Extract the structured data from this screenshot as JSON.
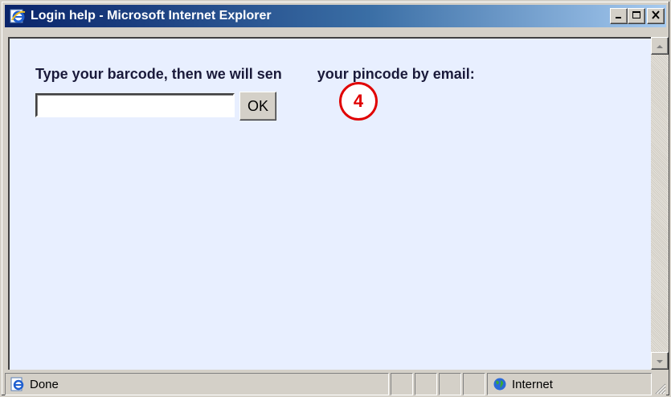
{
  "window": {
    "title": "Login help - Microsoft Internet Explorer",
    "icon": "internet-explorer-icon"
  },
  "title_buttons": {
    "minimize_icon": "minimize-icon",
    "maximize_icon": "maximize-icon",
    "close_icon": "close-icon"
  },
  "content": {
    "prompt": "Type your barcode, then we will sen",
    "prompt_tail": "your pincode by email:",
    "barcode_value": "",
    "barcode_placeholder": "",
    "ok_label": "OK",
    "marker_number": "4"
  },
  "status": {
    "text": "Done",
    "page_icon": "ie-page-icon",
    "zone_icon": "globe-icon",
    "zone_text": "Internet"
  },
  "colors": {
    "titlebar_start": "#0a246a",
    "titlebar_end": "#a6caf0",
    "content_bg": "#e8efff",
    "marker": "#e00000"
  }
}
